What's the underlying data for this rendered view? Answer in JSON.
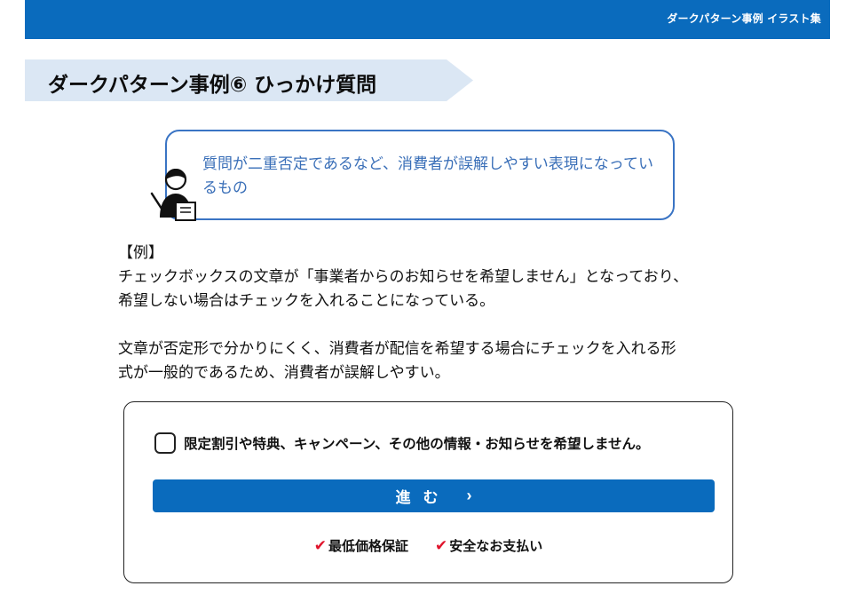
{
  "header": {
    "title": "ダークパターン事例 イラスト集"
  },
  "section": {
    "heading": "ダークパターン事例⑥ ひっかけ質問"
  },
  "callout": {
    "text": "質問が二重否定であるなど、消費者が誤解しやすい表現になっているもの"
  },
  "example": {
    "label": "【例】",
    "line1": "チェックボックスの文章が「事業者からのお知らせを希望しません」となっており、",
    "line2": "希望しない場合はチェックを入れることになっている。",
    "line3": "文章が否定形で分かりにくく、消費者が配信を希望する場合にチェックを入れる形",
    "line4": "式が一般的であるため、消費者が誤解しやすい。"
  },
  "form": {
    "checkbox_label": "限定割引や特典、キャンペーン、その他の情報・お知らせを希望しません。",
    "checkbox_checked": false,
    "proceed_label": "進む",
    "proceed_chevron": "›",
    "badges": [
      {
        "icon": "check-icon",
        "label": "最低価格保証"
      },
      {
        "icon": "check-icon",
        "label": "安全なお支払い"
      }
    ]
  },
  "colors": {
    "brand": "#0a6bbd",
    "callout_border": "#3a74c4",
    "heading_bg": "#dbe7f4",
    "check": "#e0142c"
  }
}
